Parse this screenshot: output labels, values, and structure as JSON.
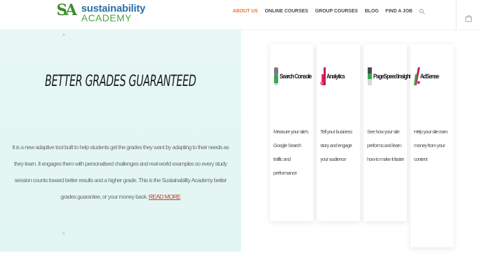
{
  "header": {
    "logo": {
      "mark": "SA",
      "line1": "sustainability",
      "line2": "ACADEMY"
    },
    "nav": [
      {
        "label": "ABOUT US",
        "active": true
      },
      {
        "label": "ONLINE COURSES",
        "active": false
      },
      {
        "label": "GROUP COURSES",
        "active": false
      },
      {
        "label": "BLOG",
        "active": false
      },
      {
        "label": "FIND A JOB",
        "active": false
      }
    ],
    "icons": {
      "search": "search-icon",
      "cart": "shopping-bag-icon"
    }
  },
  "hero": {
    "title": "BETTER GRADES GUARANTEED",
    "paragraph": "It is a new adaptive tool built to help students get the grades they want by adapting to their needs as they learn. It engages them with personalised challenges and real-world examples so every study session counts toward better results and a higher grade.",
    "paragraph_end": "This is the Sustainability Academy better grades guarantee, or your money back.",
    "link": "READ MORE",
    "colors": {
      "background": "#e4f6f4"
    }
  },
  "cards": [
    {
      "title": "Search Console",
      "desc": "Measure your site's Google Search traffic and performance",
      "icon_colors": [
        "#7a7a7a",
        "#3aa757",
        "#e8e8e8"
      ]
    },
    {
      "title": "Analytics",
      "desc": "Tell your business story and engage your audience",
      "icon_colors": [
        "#c2185b",
        "#e91e63",
        "#f06292"
      ]
    },
    {
      "title": "PageSpeed Insights",
      "desc": "See how your site performs and learn how to make it faster",
      "icon_colors": [
        "#4a4a4a",
        "#34a853",
        "#ea4335"
      ]
    },
    {
      "title": "AdSense",
      "desc": "Help your site earn money from your content",
      "icon_colors": [
        "#c2185b",
        "#43a047",
        "#e91e63"
      ]
    }
  ]
}
